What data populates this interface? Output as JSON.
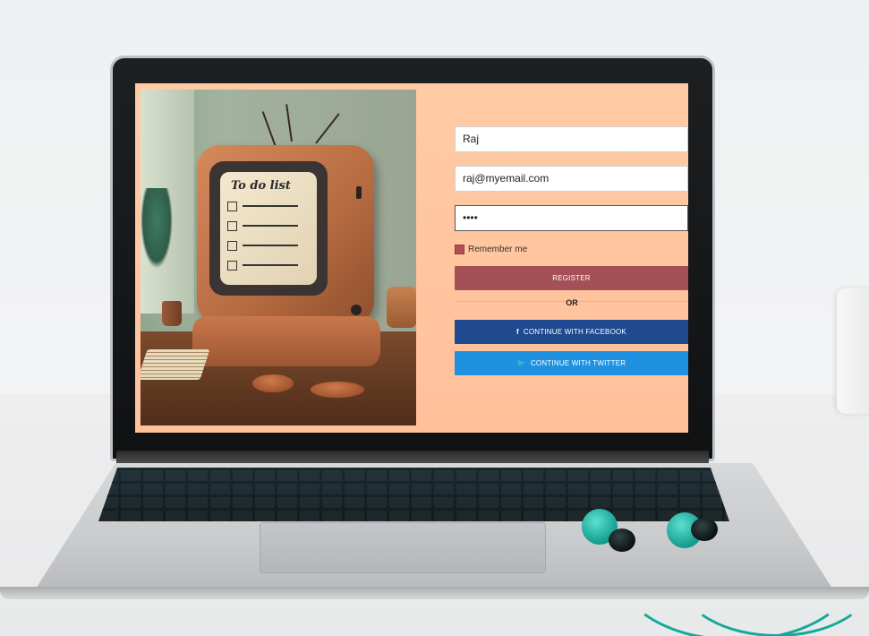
{
  "hero": {
    "tv_screen_title": "To do list"
  },
  "form": {
    "name_value": "Raj",
    "email_value": "raj@myemail.com",
    "password_value": "••••",
    "remember_label": "Remember me",
    "register_label": "REGISTER",
    "or_label": "OR",
    "facebook_label": "CONTINUE WITH FACEBOOK",
    "twitter_label": "CONTINUE WITH TWITTER",
    "facebook_icon": "f",
    "twitter_icon": "🐦"
  },
  "colors": {
    "screen_background": "#ffc9a3",
    "register_button": "#a54f57",
    "facebook_button": "#1f4a8f",
    "twitter_button": "#1e92e1",
    "checkbox": "#b15050"
  },
  "icons": {
    "facebook": "facebook-icon",
    "twitter": "twitter-icon"
  }
}
